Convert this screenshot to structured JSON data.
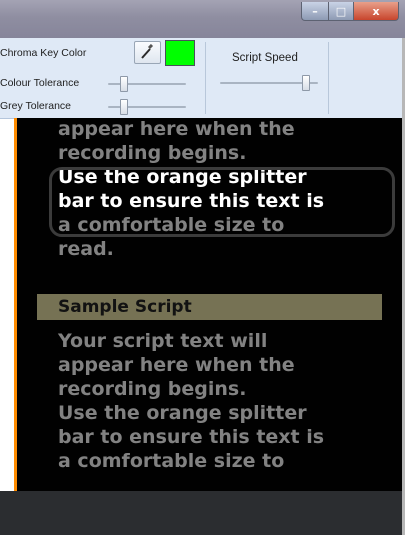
{
  "window": {
    "minimize_symbol": "–",
    "maximize_symbol": "□",
    "close_symbol": "x"
  },
  "toolbar": {
    "chroma_key_label": "Chroma Key Color",
    "chroma_key_color": "#00ff00",
    "colour_tolerance_label": "Colour Tolerance",
    "colour_tolerance_value": 0.2,
    "grey_tolerance_label": "Grey Tolerance",
    "grey_tolerance_value": 0.2,
    "script_speed_label": "Script Speed",
    "script_speed_value": 0.88
  },
  "script": {
    "top_partial_line": "appear here when the",
    "before_lines": [
      "recording begins."
    ],
    "highlight_lines": [
      "Use the orange splitter",
      "bar to ensure this text is"
    ],
    "after_lines": [
      "a comfortable size to",
      "read."
    ],
    "section_title": "Sample Script",
    "body_lines": [
      "Your script text will",
      "appear here when the",
      "recording begins.",
      "Use the orange splitter",
      "bar to ensure this text is",
      "a comfortable size to"
    ]
  },
  "colors": {
    "splitter": "#ff8c00",
    "section_bar": "#767254",
    "dim_text": "#828282",
    "highlight_text": "#ffffff"
  }
}
